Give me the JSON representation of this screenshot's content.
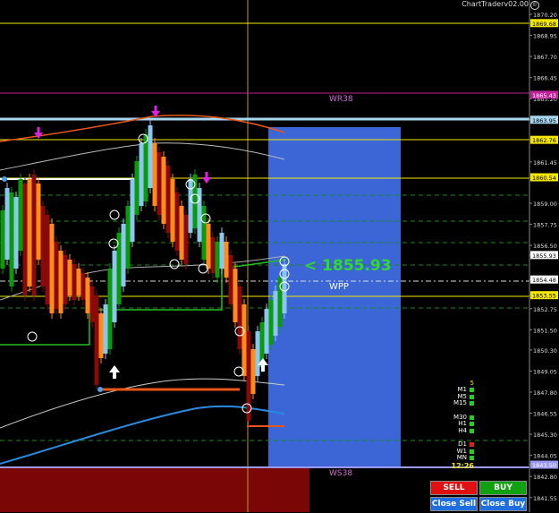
{
  "brand": {
    "name": "ChartTraderv02.00",
    "icon": "copyright-icon"
  },
  "levels": {
    "wr38": "WR38",
    "ws38": "WS38",
    "wpp": "WPP"
  },
  "current_price_display": "< 1855.93",
  "timeframes": {
    "count": "5",
    "rows": [
      {
        "label": "M1",
        "color": "#1ed21e"
      },
      {
        "label": "M5",
        "color": "#1ed21e"
      },
      {
        "label": "M15",
        "color": "#1ed21e"
      },
      {
        "label": "M30",
        "color": "#1ed21e"
      },
      {
        "label": "H1",
        "color": "#1ed21e"
      },
      {
        "label": "H4",
        "color": "#1ed21e"
      },
      {
        "label": "D1",
        "color": "#e02020"
      },
      {
        "label": "W1",
        "color": "#1ed21e"
      },
      {
        "label": "MN",
        "color": "#1ed21e"
      }
    ],
    "time": "12:26"
  },
  "trade": {
    "sell_label": "SELL",
    "buy_label": "BUY",
    "close_sell_label": "Close Sell",
    "close_buy_label": "Close Buy"
  },
  "axis": {
    "ticks": [
      "1870.20",
      "1868.95",
      "1867.70",
      "1866.45",
      "1865.20",
      "1863.95",
      "1862.76",
      "1861.45",
      "1860.54",
      "1859.00",
      "1857.75",
      "1856.50",
      "1855.93",
      "1854.48",
      "1853.55",
      "1852.75",
      "1851.50",
      "1850.30",
      "1849.05",
      "1847.80",
      "1846.55",
      "1845.30",
      "1844.05",
      "1843.50",
      "1842.80",
      "1841.55"
    ],
    "highlight_boxes": [
      {
        "value": "1869.68",
        "color": "#f5e800"
      },
      {
        "value": "1865.43",
        "color": "#c0229a"
      },
      {
        "value": "1863.95",
        "color": "#a8d8f0"
      },
      {
        "value": "1862.76",
        "color": "#f5e800"
      },
      {
        "value": "1860.54",
        "color": "#f5e800"
      },
      {
        "value": "1855.93",
        "color": "#ffffff"
      },
      {
        "value": "1854.48",
        "color": "#ffffff"
      },
      {
        "value": "1853.55",
        "color": "#f5e800"
      },
      {
        "value": "1843.50",
        "color": "#9a9af0"
      }
    ]
  },
  "colors": {
    "bull_strong": "#0a9a0a",
    "bull_light": "#8ac6f0",
    "bear_strong": "#8a0a0a",
    "bear_light": "#ff8c1a",
    "zone_blue": "#3f6be0",
    "zone_red": "#7a0606"
  }
}
